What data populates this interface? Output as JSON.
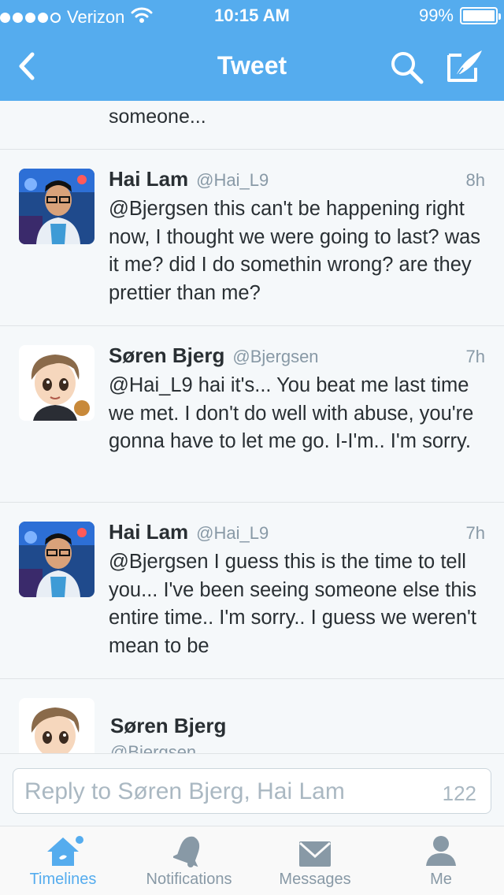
{
  "status_bar": {
    "carrier": "Verizon",
    "time": "10:15 AM",
    "battery": "99%",
    "battery_level": 0.99,
    "signal_bars": 4,
    "signal_total": 5
  },
  "nav": {
    "title": "Tweet",
    "back_icon": "chevron-left-icon",
    "search_icon": "search-icon",
    "compose_icon": "compose-icon"
  },
  "feed": {
    "partial_top_text": "someone...",
    "tweets": [
      {
        "name": "Hai Lam",
        "handle": "@Hai_L9",
        "time": "8h",
        "text": "@Bjergsen this can't be happening right now, I thought we were going to last? was it me? did I do somethin wrong? are they prettier than me?"
      },
      {
        "name": "Søren Bjerg",
        "handle": "@Bjergsen",
        "time": "7h",
        "text": "@Hai_L9 hai it's... You beat me last time we met. I don't do well with abuse, you're gonna have to let me go. I-I'm.. I'm sorry."
      },
      {
        "name": "Hai Lam",
        "handle": "@Hai_L9",
        "time": "7h",
        "text": "@Bjergsen I guess this is the time to tell you... I've been seeing someone else this entire time.. I'm sorry.. I guess we weren't mean to be"
      }
    ],
    "partial_bottom": {
      "name": "Søren Bjerg",
      "handle": "@Bjergsen"
    }
  },
  "reply": {
    "placeholder": "Reply to Søren Bjerg, Hai Lam",
    "char_count": "122"
  },
  "tabs": [
    {
      "label": "Timelines",
      "icon": "home-icon",
      "active": true
    },
    {
      "label": "Notifications",
      "icon": "bell-icon",
      "active": false
    },
    {
      "label": "Messages",
      "icon": "envelope-icon",
      "active": false
    },
    {
      "label": "Me",
      "icon": "person-icon",
      "active": false
    }
  ],
  "colors": {
    "brand": "#55acee",
    "text": "#292f33",
    "muted": "#8899a6",
    "background": "#f5f8fa"
  }
}
